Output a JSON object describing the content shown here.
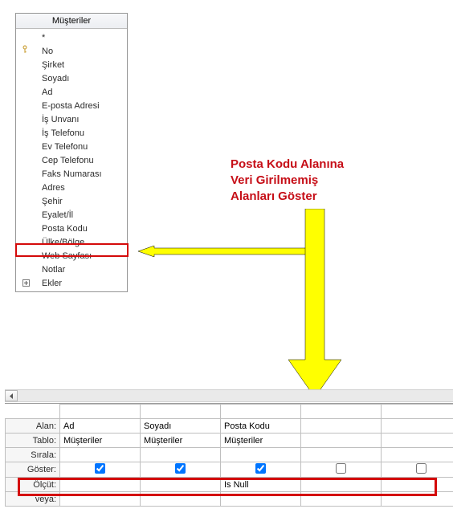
{
  "field_panel": {
    "title": "Müşteriler",
    "fields": [
      {
        "label": "*",
        "key": false,
        "expand": false
      },
      {
        "label": "No",
        "key": true,
        "expand": false
      },
      {
        "label": "Şirket",
        "key": false,
        "expand": false
      },
      {
        "label": "Soyadı",
        "key": false,
        "expand": false
      },
      {
        "label": "Ad",
        "key": false,
        "expand": false
      },
      {
        "label": "E-posta Adresi",
        "key": false,
        "expand": false
      },
      {
        "label": "İş Unvanı",
        "key": false,
        "expand": false
      },
      {
        "label": "İş Telefonu",
        "key": false,
        "expand": false
      },
      {
        "label": "Ev Telefonu",
        "key": false,
        "expand": false
      },
      {
        "label": "Cep Telefonu",
        "key": false,
        "expand": false
      },
      {
        "label": "Faks Numarası",
        "key": false,
        "expand": false
      },
      {
        "label": "Adres",
        "key": false,
        "expand": false
      },
      {
        "label": "Şehir",
        "key": false,
        "expand": false
      },
      {
        "label": "Eyalet/İl",
        "key": false,
        "expand": false
      },
      {
        "label": "Posta Kodu",
        "key": false,
        "expand": false
      },
      {
        "label": "Ülke/Bölge",
        "key": false,
        "expand": false
      },
      {
        "label": "Web Sayfası",
        "key": false,
        "expand": false
      },
      {
        "label": "Notlar",
        "key": false,
        "expand": false
      },
      {
        "label": "Ekler",
        "key": false,
        "expand": true
      }
    ]
  },
  "annotation": {
    "line1": "Posta Kodu Alanına",
    "line2": "Veri Girilmemiş",
    "line3": "Alanları Göster"
  },
  "grid": {
    "row_labels": {
      "alan": "Alan:",
      "tablo": "Tablo:",
      "sirala": "Sırala:",
      "goster": "Göster:",
      "olcut": "Ölçüt:",
      "veya": "veya:"
    },
    "columns": [
      {
        "alan": "Ad",
        "tablo": "Müşteriler",
        "sirala": "",
        "goster": true,
        "olcut": "",
        "veya": ""
      },
      {
        "alan": "Soyadı",
        "tablo": "Müşteriler",
        "sirala": "",
        "goster": true,
        "olcut": "",
        "veya": ""
      },
      {
        "alan": "Posta Kodu",
        "tablo": "Müşteriler",
        "sirala": "",
        "goster": true,
        "olcut": "Is Null",
        "veya": ""
      },
      {
        "alan": "",
        "tablo": "",
        "sirala": "",
        "goster": false,
        "olcut": "",
        "veya": ""
      },
      {
        "alan": "",
        "tablo": "",
        "sirala": "",
        "goster": false,
        "olcut": "",
        "veya": ""
      }
    ]
  }
}
